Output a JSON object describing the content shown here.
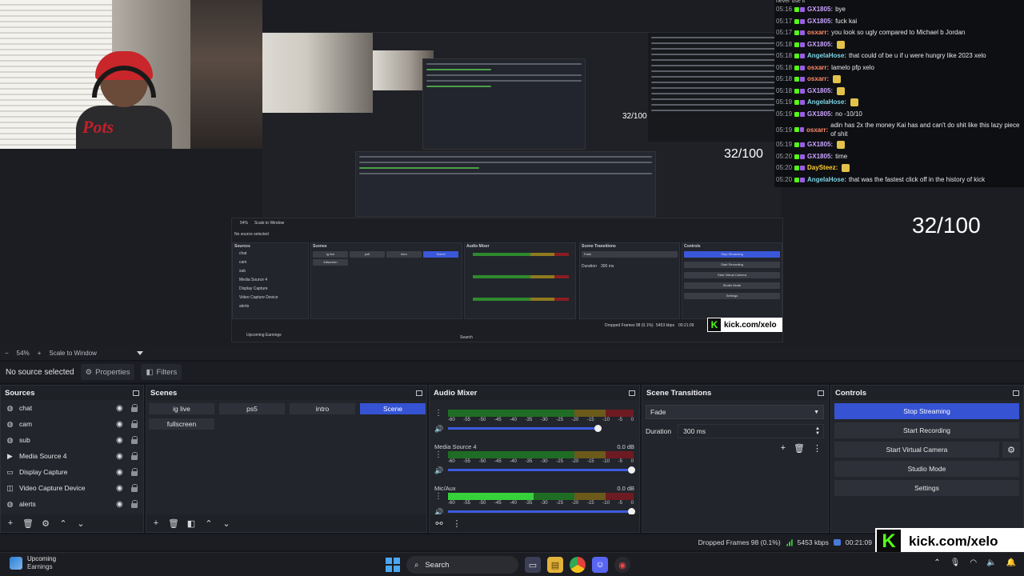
{
  "preview": {
    "counter_small": "32/100",
    "counter_mid": "32/100",
    "counter_big": "32/100",
    "nested_kick": "kick.com/xelo",
    "nested_dropped": "Dropped Frames 98 (0.1%)",
    "nested_kbps": "5453 kbps",
    "nested_time": "00:21:09",
    "nested_sources_title": "Sources",
    "nested_scenes_title": "Scenes",
    "nested_mixer_title": "Audio Mixer",
    "nested_transitions_title": "Scene Transitions",
    "nested_controls_title": "Controls",
    "nested_no_source": "No source selected",
    "nested_sources": [
      "chat",
      "cam",
      "sub",
      "Media Source 4",
      "Display Capture",
      "Video Capture Device",
      "alerts"
    ],
    "nested_scenes": [
      "ig live",
      "ps5",
      "intro",
      "Scene",
      "fullscreen"
    ],
    "nested_controls": [
      "Stop Streaming",
      "Start Recording",
      "Start Virtual Camera",
      "Studio Mode",
      "Settings"
    ],
    "nested_fade": "Fade",
    "nested_duration": "Duration",
    "nested_duration_val": "300 ms",
    "nested_search": "Search",
    "nested_weather": "Upcoming Earnings",
    "nested_zoom": "54%",
    "nested_scale": "Scale to Window"
  },
  "chat": {
    "top_text": "never use it",
    "lines": [
      {
        "ts": "05:16",
        "user": "GX1805:",
        "color": "#c9a3ff",
        "msg": "bye"
      },
      {
        "ts": "05:17",
        "user": "GX1805:",
        "color": "#c9a3ff",
        "msg": "fuck kai"
      },
      {
        "ts": "05:17",
        "user": "osxarr:",
        "color": "#ff8b6b",
        "msg": "you look so ugly compared to Michael b Jordan"
      },
      {
        "ts": "05:18",
        "user": "GX1805:",
        "color": "#c9a3ff",
        "msg": ""
      },
      {
        "ts": "05:18",
        "user": "AngelaHose:",
        "color": "#7fd4e6",
        "msg": "that could of be u if u were hungry like 2023 xelo"
      },
      {
        "ts": "05:18",
        "user": "osxarr:",
        "color": "#ff8b6b",
        "msg": "lamelo pfp xelo"
      },
      {
        "ts": "05:18",
        "user": "osxarr:",
        "color": "#ff8b6b",
        "msg": ""
      },
      {
        "ts": "05:18",
        "user": "GX1805:",
        "color": "#c9a3ff",
        "msg": ""
      },
      {
        "ts": "05:19",
        "user": "AngelaHose:",
        "color": "#7fd4e6",
        "msg": ""
      },
      {
        "ts": "05:19",
        "user": "GX1805:",
        "color": "#c9a3ff",
        "msg": "no -10/10"
      },
      {
        "ts": "05:19",
        "user": "osxarr:",
        "color": "#ff8b6b",
        "msg": "adin has 2x the money Kai has and can't do shit like this lazy piece of shit",
        "wrap": true
      },
      {
        "ts": "05:19",
        "user": "GX1805:",
        "color": "#c9a3ff",
        "msg": ""
      },
      {
        "ts": "05:20",
        "user": "GX1805:",
        "color": "#c9a3ff",
        "msg": "time"
      },
      {
        "ts": "05:20",
        "user": "DaySteez:",
        "color": "#ffcc33",
        "msg": ""
      },
      {
        "ts": "05:20",
        "user": "AngelaHose:",
        "color": "#7fd4e6",
        "msg": "that was the fastest click off in the history of kick"
      }
    ]
  },
  "zoombar": {
    "zoom": "54%",
    "scale": "Scale to Window"
  },
  "propbar": {
    "no_source": "No source selected",
    "properties": "Properties",
    "filters": "Filters"
  },
  "sources": {
    "title": "Sources",
    "items": [
      {
        "name": "chat",
        "icon": "globe-icon"
      },
      {
        "name": "cam",
        "icon": "globe-icon"
      },
      {
        "name": "sub",
        "icon": "globe-icon"
      },
      {
        "name": "Media Source 4",
        "icon": "play-icon"
      },
      {
        "name": "Display Capture",
        "icon": "monitor-icon"
      },
      {
        "name": "Video Capture Device",
        "icon": "camera-icon"
      },
      {
        "name": "alerts",
        "icon": "globe-icon"
      }
    ]
  },
  "scenes": {
    "title": "Scenes",
    "items": [
      "ig live",
      "ps5",
      "intro",
      "Scene",
      "fullscreen"
    ],
    "active": "Scene"
  },
  "mixer": {
    "title": "Audio Mixer",
    "scale": [
      "-60",
      "-55",
      "-50",
      "-45",
      "-40",
      "-35",
      "-30",
      "-25",
      "-20",
      "-15",
      "-10",
      "-5",
      "0"
    ],
    "channels": [
      {
        "name": "",
        "db": "",
        "level": 0.0,
        "volume": 0.82
      },
      {
        "name": "Media Source 4",
        "db": "0.0 dB",
        "level": 0.0,
        "volume": 1.0
      },
      {
        "name": "Mic/Aux",
        "db": "0.0 dB",
        "level": 0.46,
        "volume": 1.0
      }
    ]
  },
  "transitions": {
    "title": "Scene Transitions",
    "type": "Fade",
    "duration_label": "Duration",
    "duration": "300 ms"
  },
  "controls": {
    "title": "Controls",
    "stop_streaming": "Stop Streaming",
    "start_recording": "Start Recording",
    "start_virtual_camera": "Start Virtual Camera",
    "studio_mode": "Studio Mode",
    "settings": "Settings"
  },
  "status": {
    "dropped": "Dropped Frames 98 (0.1%)",
    "kbps": "5453 kbps",
    "time": "00:21:09"
  },
  "kick": {
    "url": "kick.com/xelo"
  },
  "taskbar": {
    "weather_title": "Upcoming",
    "weather_sub": "Earnings",
    "search": "Search"
  },
  "colors": {
    "accent": "#3553d3",
    "kick_green": "#53fc18"
  }
}
